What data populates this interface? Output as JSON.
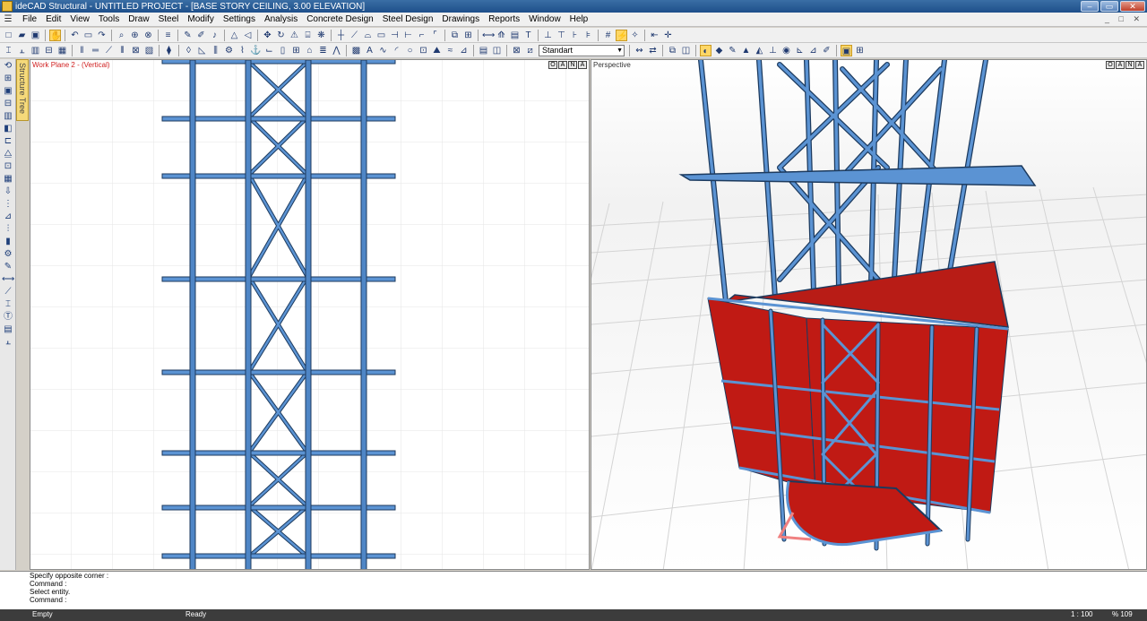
{
  "window": {
    "title": "ideCAD Structural - UNTITLED PROJECT - [BASE STORY CEILING,  3.00 ELEVATION]",
    "minimize": "–",
    "restore": "▭",
    "close": "✕"
  },
  "menu": {
    "items": [
      "File",
      "Edit",
      "View",
      "Tools",
      "Draw",
      "Steel",
      "Modify",
      "Settings",
      "Analysis",
      "Concrete Design",
      "Steel Design",
      "Drawings",
      "Reports",
      "Window",
      "Help"
    ],
    "mdi_controls": "_ □ ✕"
  },
  "toolbar": {
    "view_combo": "Standart"
  },
  "sidebar": {
    "structure_tree_tab": "Structure Tree"
  },
  "viewports": {
    "left": {
      "label": "Work Plane 2 - (Vertical)",
      "buttons": [
        "O",
        "A",
        "N",
        "A"
      ]
    },
    "right": {
      "label": "Perspective",
      "buttons": [
        "O",
        "A",
        "N",
        "A"
      ]
    }
  },
  "command": {
    "lines": [
      "Specify opposite corner :",
      "Command :",
      "Select entity.",
      "Command :"
    ]
  },
  "status": {
    "left": "Empty",
    "center": "Ready",
    "scale": "1 : 100",
    "zoom": "% 109"
  },
  "colors": {
    "steel_member": "#4f86c6",
    "steel_outline": "#1c3a5e",
    "wall_panel": "#c01a14",
    "title_bar": "#2a5d97",
    "axis_marker": "#f08080"
  }
}
